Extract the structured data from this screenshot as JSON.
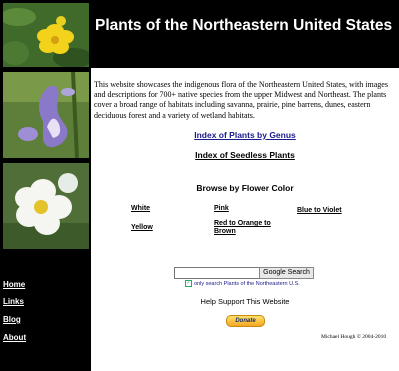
{
  "header": {
    "title": "Plants of the Northeastern United States"
  },
  "intro": "This website showcases the indigenous flora of the Northeastern United States, with images and descriptions for 700+ native species from the upper Midwest and Northeast. The plants cover a broad range of habitats including savanna, prairie, pine barrens, dunes, eastern deciduous forest and a variety of wetland habitats.",
  "links": {
    "genus": "Index of Plants by Genus",
    "seedless": "Index of Seedless Plants"
  },
  "browse": {
    "heading": "Browse by Flower Color",
    "colors": {
      "white": "White",
      "pink": "Pink",
      "blue_violet": "Blue to Violet",
      "yellow": "Yellow",
      "red_orange_brown": "Red to Orange to Brown"
    }
  },
  "search": {
    "value": "",
    "button": "Google Search",
    "scope": "only search Plants of the Northeastern U.S."
  },
  "support": {
    "text": "Help Support This Website",
    "donate": "Donate"
  },
  "copyright": "Michael Hough © 2004-2010",
  "nav": {
    "home": "Home",
    "links": "Links",
    "blog": "Blog",
    "about": "About"
  },
  "icons": {
    "checkbox": "checkmark-icon"
  }
}
